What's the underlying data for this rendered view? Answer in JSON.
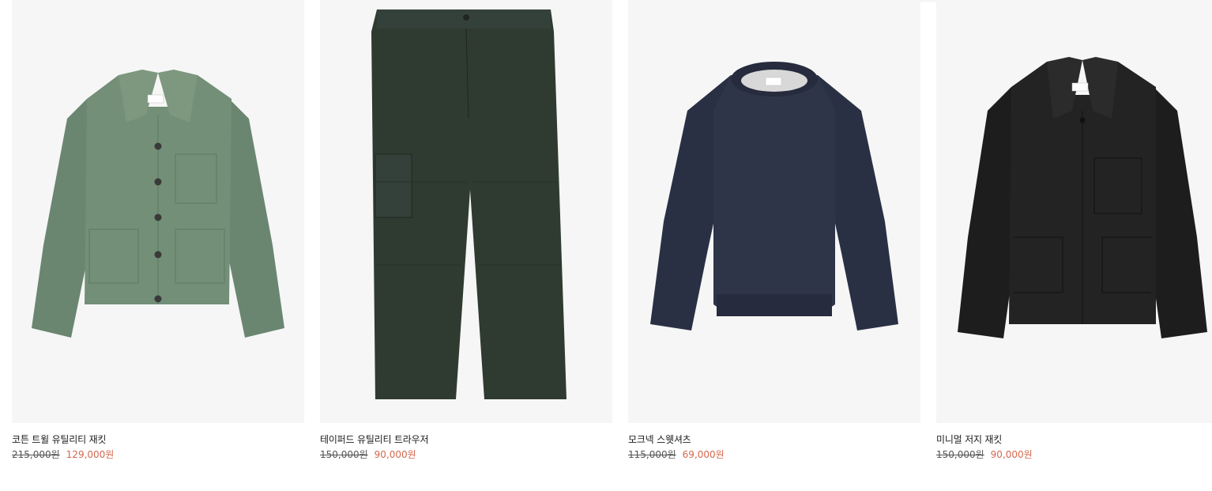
{
  "products": [
    {
      "name": "코튼 트윌 유틸리티 재킷",
      "original_price": "215,000원",
      "sale_price": "129,000원",
      "image_icon": "green-utility-jacket-image",
      "color": "#6f8a72"
    },
    {
      "name": "테이퍼드 유틸리티 트라우저",
      "original_price": "150,000원",
      "sale_price": "90,000원",
      "image_icon": "dark-green-trousers-image",
      "color": "#2f3b30"
    },
    {
      "name": "모크넥 스웻셔츠",
      "original_price": "115,000원",
      "sale_price": "69,000원",
      "image_icon": "navy-sweatshirt-image",
      "color": "#2c3246"
    },
    {
      "name": "미니멀 저지 재킷",
      "original_price": "150,000원",
      "sale_price": "90,000원",
      "image_icon": "black-jersey-jacket-image",
      "color": "#222222"
    }
  ],
  "colors": {
    "image_bg": "#f6f6f6",
    "sale_price": "#d4684f",
    "text": "#1a1a1a"
  }
}
